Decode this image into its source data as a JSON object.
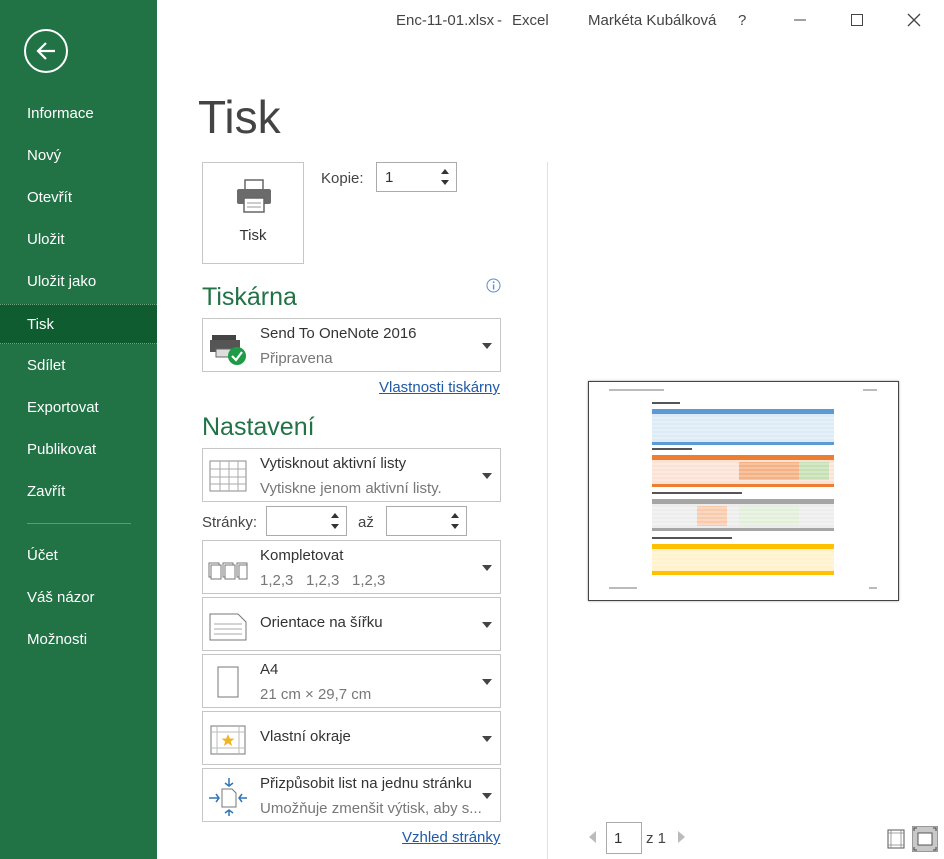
{
  "window": {
    "filename": "Enc-11-01.xlsx",
    "separator": "-",
    "app": "Excel",
    "user": "Markéta Kubálková",
    "help": "?"
  },
  "sidebar": {
    "items": [
      {
        "label": "Informace"
      },
      {
        "label": "Nový"
      },
      {
        "label": "Otevřít"
      },
      {
        "label": "Uložit"
      },
      {
        "label": "Uložit jako"
      },
      {
        "label": "Tisk"
      },
      {
        "label": "Sdílet"
      },
      {
        "label": "Exportovat"
      },
      {
        "label": "Publikovat"
      },
      {
        "label": "Zavřít"
      }
    ],
    "bottom_items": [
      {
        "label": "Účet"
      },
      {
        "label": "Váš názor"
      },
      {
        "label": "Možnosti"
      }
    ],
    "active": "Tisk"
  },
  "page": {
    "title": "Tisk",
    "print_button": "Tisk",
    "copies_label": "Kopie:",
    "copies_value": "1"
  },
  "printer": {
    "section_title": "Tiskárna",
    "name": "Send To OneNote 2016",
    "status": "Připravena",
    "properties_link": "Vlastnosti tiskárny",
    "info_icon": "info-icon"
  },
  "settings": {
    "section_title": "Nastavení",
    "what_to_print": {
      "title": "Vytisknout aktivní listy",
      "subtitle": "Vytiskne jenom aktivní listy."
    },
    "pages_label": "Stránky:",
    "pages_to_label": "až",
    "collate": {
      "title": "Kompletovat",
      "s1": "1,2,3",
      "s2": "1,2,3",
      "s3": "1,2,3"
    },
    "orientation": {
      "title": "Orientace na šířku"
    },
    "paper": {
      "title": "A4",
      "subtitle": "21 cm × 29,7 cm"
    },
    "margins": {
      "title": "Vlastní okraje"
    },
    "scaling": {
      "title": "Přizpůsobit list na jednu stránku",
      "subtitle": "Umožňuje zmenšit výtisk, aby s..."
    },
    "page_setup_link": "Vzhled stránky"
  },
  "preview_pager": {
    "current": "1",
    "of_text": "z 1"
  },
  "colors": {
    "accent": "#217346",
    "active_nav": "#0f5c30",
    "link": "#1e5aa8"
  }
}
